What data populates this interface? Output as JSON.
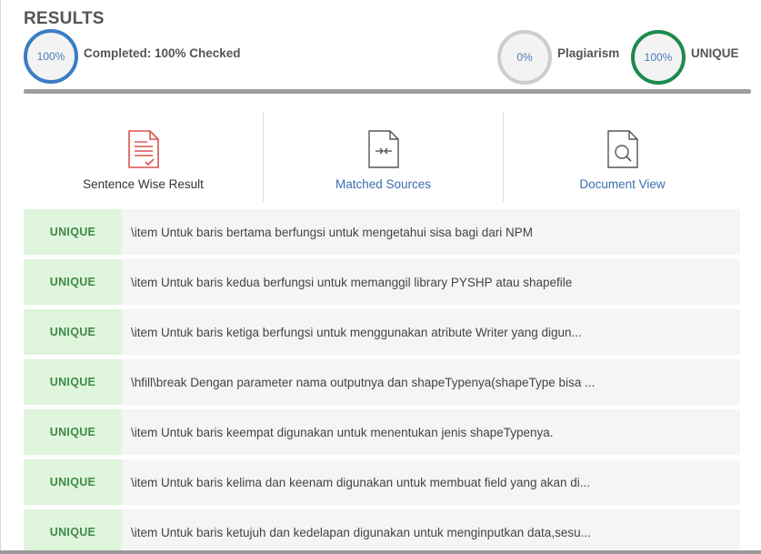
{
  "header": {
    "title": "RESULTS",
    "completed_percent": "100%",
    "completed_label": "Completed: 100% Checked",
    "plagiarism_percent": "0%",
    "plagiarism_label": "Plagiarism",
    "unique_percent": "100%",
    "unique_label": "UNIQUE"
  },
  "tabs": [
    {
      "label": "Sentence Wise Result",
      "icon": "document-check-icon",
      "active": true
    },
    {
      "label": "Matched Sources",
      "icon": "document-compare-icon",
      "active": false
    },
    {
      "label": "Document View",
      "icon": "document-search-icon",
      "active": false
    }
  ],
  "colors": {
    "completed_ring": "#3b7dc4",
    "plagiarism_ring": "#cdcdcd",
    "unique_ring": "#1e8a4c",
    "unique_badge_bg": "#dff5dc",
    "unique_badge_text": "#3e8a47",
    "link": "#3a6fb0",
    "active_icon": "#d9534f"
  },
  "results": [
    {
      "status": "UNIQUE",
      "text": "\\item Untuk baris bertama berfungsi untuk mengetahui sisa bagi dari NPM"
    },
    {
      "status": "UNIQUE",
      "text": "\\item Untuk baris kedua berfungsi untuk memanggil library PYSHP atau shapefile"
    },
    {
      "status": "UNIQUE",
      "text": "\\item Untuk baris ketiga berfungsi untuk menggunakan atribute Writer yang digun..."
    },
    {
      "status": "UNIQUE",
      "text": "\\hfill\\break Dengan parameter nama outputnya dan shapeTypenya(shapeType bisa ..."
    },
    {
      "status": "UNIQUE",
      "text": "\\item Untuk baris keempat digunakan untuk menentukan jenis shapeTypenya."
    },
    {
      "status": "UNIQUE",
      "text": "\\item Untuk baris kelima dan keenam digunakan untuk membuat field yang akan di..."
    },
    {
      "status": "UNIQUE",
      "text": "\\item Untuk baris ketujuh dan kedelapan digunakan untuk menginputkan data,sesu..."
    }
  ]
}
